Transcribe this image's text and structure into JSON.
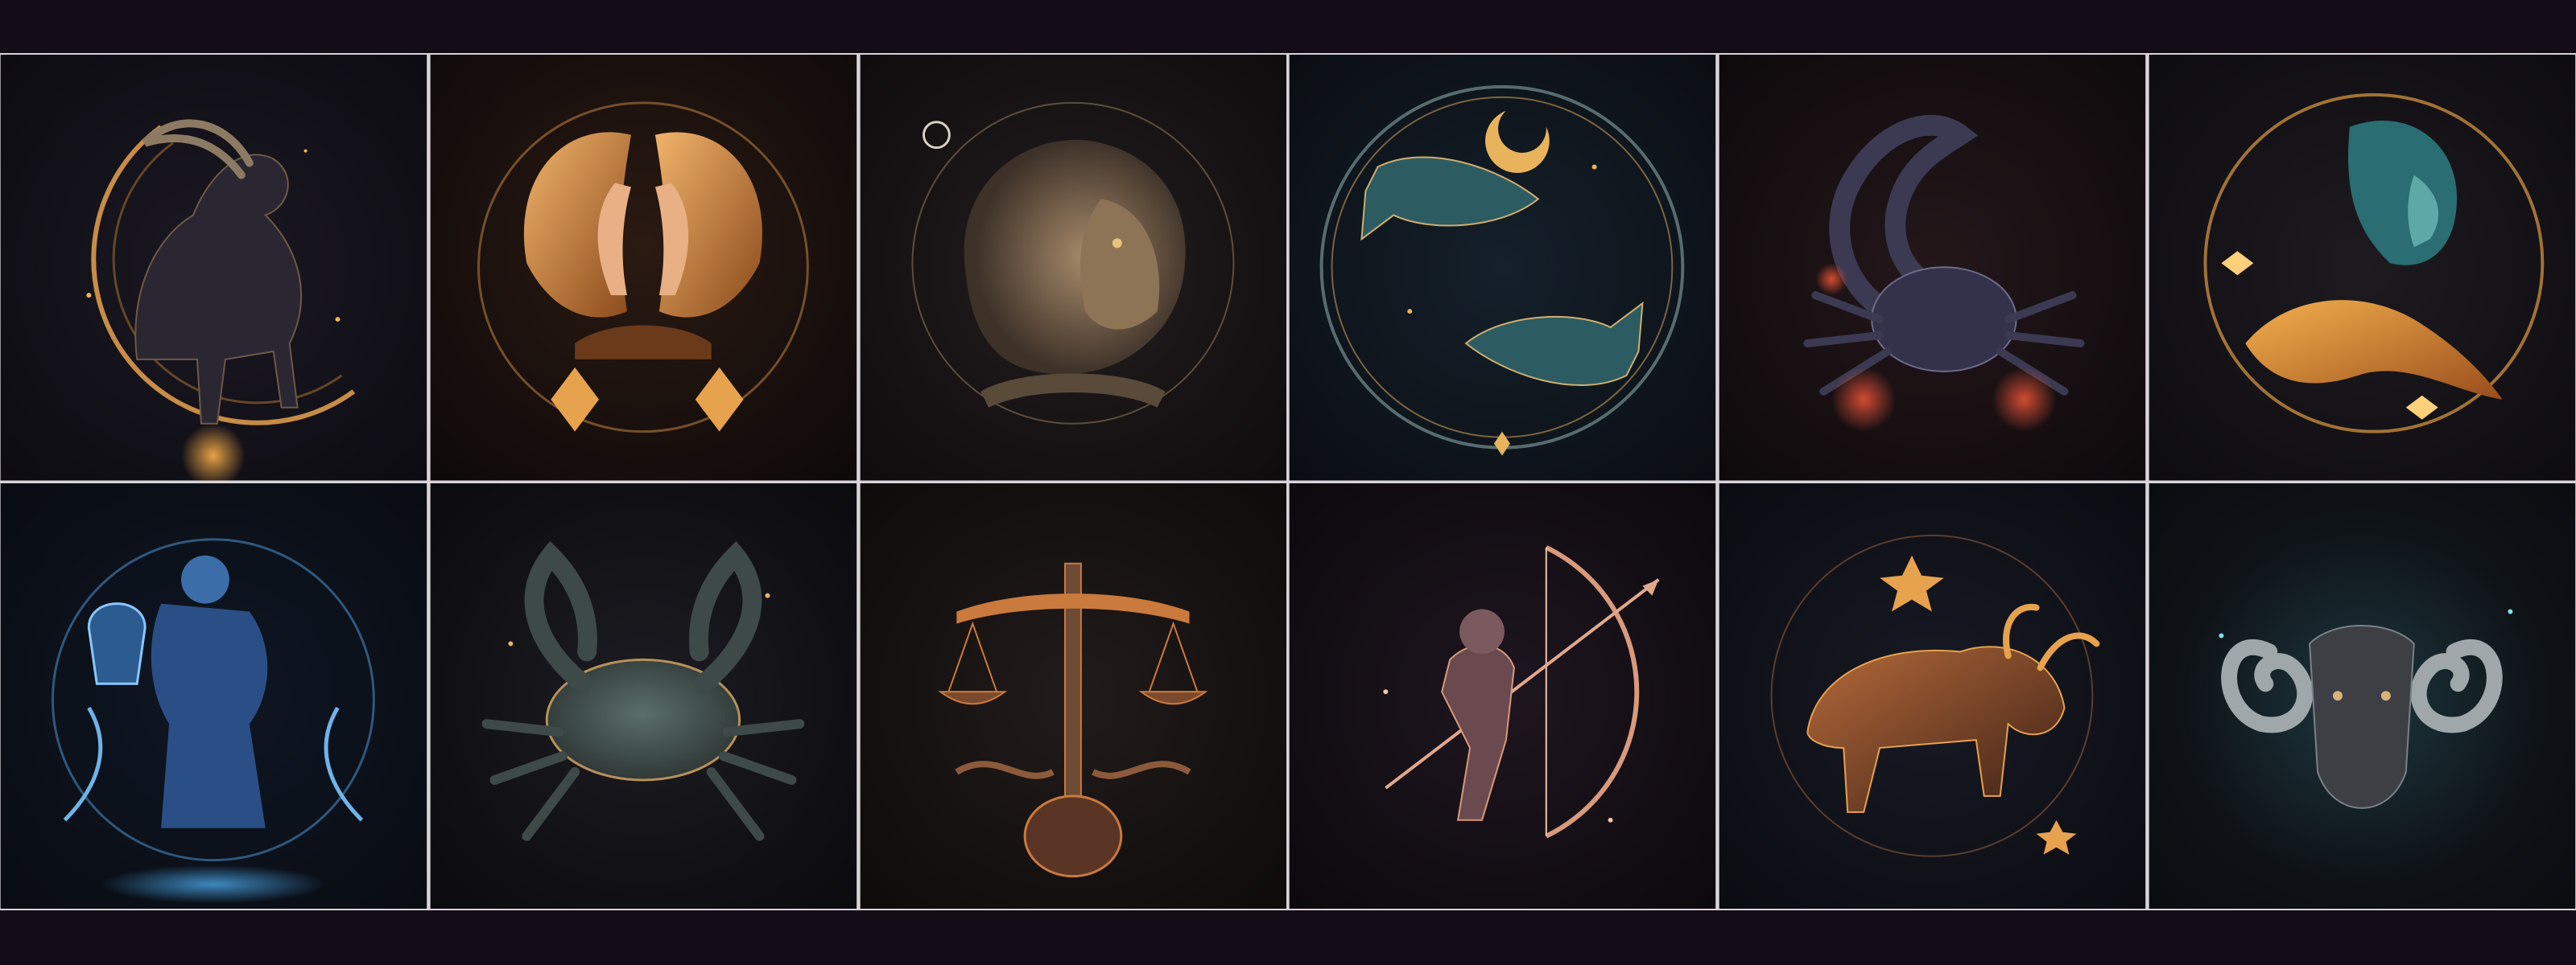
{
  "colors": {
    "page_background": "#140d17",
    "divider": "#d8d4da",
    "gold": "#e6a24d",
    "copper": "#c97a3c",
    "teal": "#3fb6c4",
    "blue": "#4aa6e8"
  },
  "tiles": [
    {
      "name": "capricorn",
      "row": 1,
      "col": 1,
      "icon": "goat-with-crescent-icon",
      "accent": "#e6a24d"
    },
    {
      "name": "gemini",
      "row": 1,
      "col": 2,
      "icon": "twin-faces-icon",
      "accent": "#e6a24d"
    },
    {
      "name": "leo",
      "row": 1,
      "col": 3,
      "icon": "lion-head-icon",
      "accent": "#b8a07a"
    },
    {
      "name": "pisces",
      "row": 1,
      "col": 4,
      "icon": "two-fish-icon",
      "accent": "#3fb6c4"
    },
    {
      "name": "scorpio",
      "row": 1,
      "col": 5,
      "icon": "scorpion-icon",
      "accent": "#e2533b"
    },
    {
      "name": "virgo",
      "row": 1,
      "col": 6,
      "icon": "maiden-profile-icon",
      "accent": "#3fb6c4"
    },
    {
      "name": "aquarius",
      "row": 2,
      "col": 1,
      "icon": "water-bearer-icon",
      "accent": "#4aa6e8"
    },
    {
      "name": "cancer",
      "row": 2,
      "col": 2,
      "icon": "crab-icon",
      "accent": "#b7905a"
    },
    {
      "name": "libra",
      "row": 2,
      "col": 3,
      "icon": "scales-icon",
      "accent": "#c97a3c"
    },
    {
      "name": "sagittarius",
      "row": 2,
      "col": 4,
      "icon": "archer-with-bow-icon",
      "accent": "#e59a7a"
    },
    {
      "name": "taurus",
      "row": 2,
      "col": 5,
      "icon": "bull-icon",
      "accent": "#e6a24d"
    },
    {
      "name": "aries",
      "row": 2,
      "col": 6,
      "icon": "ram-head-icon",
      "accent": "#3fb6c4"
    }
  ]
}
